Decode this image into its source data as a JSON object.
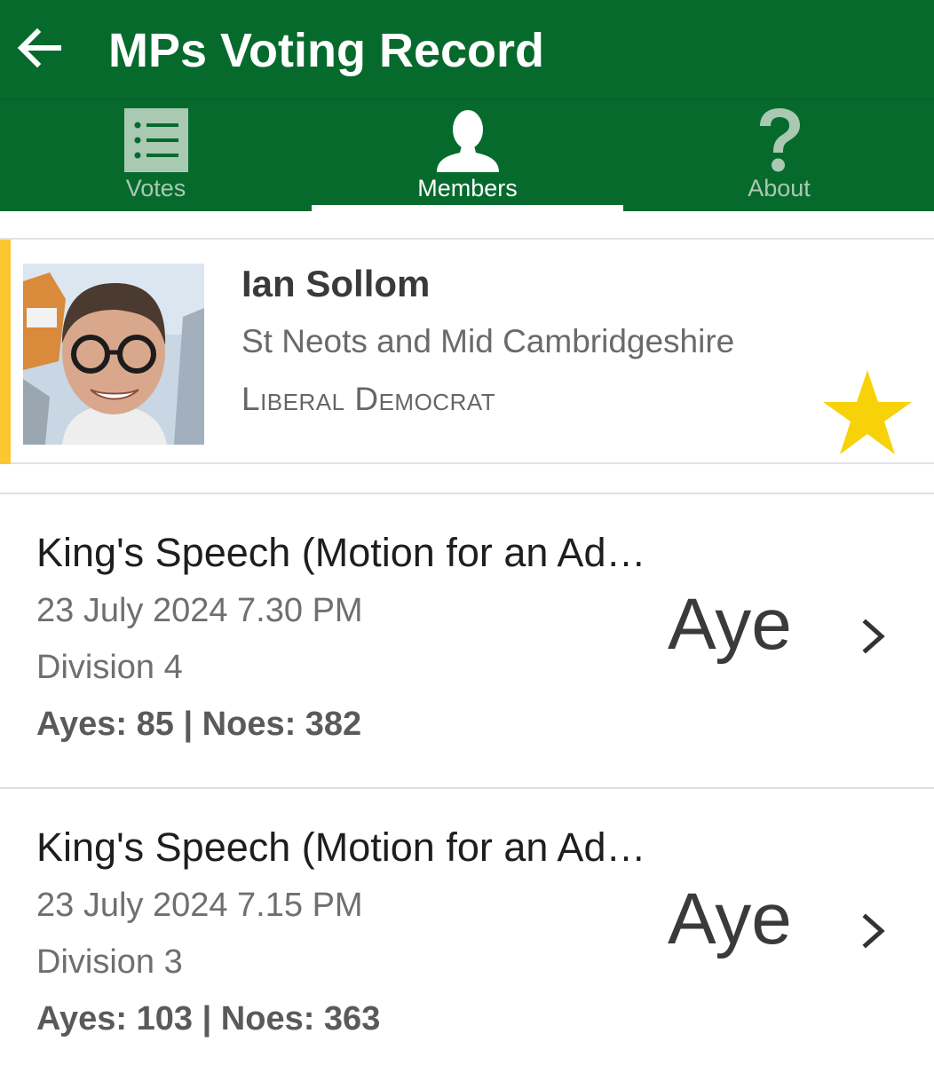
{
  "appbar": {
    "title": "MPs Voting Record",
    "back_icon": "arrow-left-icon"
  },
  "tabs": [
    {
      "label": "Votes",
      "icon": "list-icon",
      "selected": false
    },
    {
      "label": "Members",
      "icon": "person-icon",
      "selected": true
    },
    {
      "label": "About",
      "icon": "question-icon",
      "selected": false
    }
  ],
  "member": {
    "name": "Ian Sollom",
    "constituency": "St Neots and Mid Cambridgeshire",
    "party": "Liberal Democrat",
    "party_color": "#fac731",
    "favourite": true,
    "star_color": "#f8d208"
  },
  "votes": [
    {
      "title": "King's Speech (Motion for an Ad…",
      "date": "23 July 2024 7.30 PM",
      "division": "Division 4",
      "tally": "Ayes: 85 | Noes: 382",
      "result": "Aye"
    },
    {
      "title": "King's Speech (Motion for an Ad…",
      "date": "23 July 2024 7.15 PM",
      "division": "Division 3",
      "tally": "Ayes: 103 | Noes: 363",
      "result": "Aye"
    }
  ],
  "colors": {
    "primary": "#066a2d",
    "tab_inactive": "#a9c9b2",
    "accent": "#ffffff"
  }
}
